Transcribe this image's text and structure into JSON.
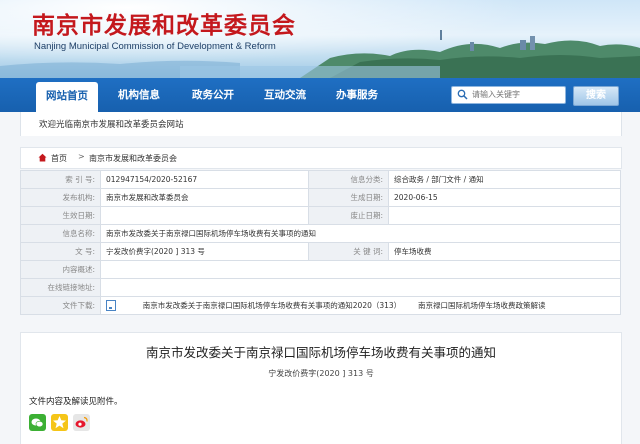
{
  "header": {
    "title": "南京市发展和改革委员会",
    "subtitle": "Nanjing Municipal Commission of Development & Reform"
  },
  "nav": {
    "items": [
      "网站首页",
      "机构信息",
      "政务公开",
      "互动交流",
      "办事服务"
    ],
    "active_index": 0
  },
  "search": {
    "placeholder": "请输入关键字",
    "button_label": "搜索"
  },
  "welcome": "欢迎光临南京市发展和改革委员会网站",
  "breadcrumb": [
    "首页",
    "南京市发展和改革委员会"
  ],
  "info_table": {
    "index_label": "索 引 号:",
    "index_value": "012947154/2020-52167",
    "category_label": "信息分类:",
    "category_value": "综合政务 / 部门文件 / 通知",
    "issuer_label": "发布机构:",
    "issuer_value": "南京市发展和改革委员会",
    "gen_date_label": "生成日期:",
    "gen_date_value": "2020-06-15",
    "effective_label": "生效日期:",
    "effective_value": "",
    "expiry_label": "废止日期:",
    "expiry_value": "",
    "name_label": "信息名称:",
    "name_value": "南京市发改委关于南京禄口国际机场停车场收费有关事项的通知",
    "docno_label": "文       号:",
    "docno_value": "宁发改价费字(2020 ] 313 号",
    "keywords_label": "关 键 词:",
    "keywords_value": "停车场收费",
    "overview_label": "内容概述:",
    "overview_value": "",
    "interview_label": "在线链接地址:",
    "interview_value": "",
    "download_label": "文件下载:",
    "download_file1": "南京市发改委关于南京禄口国际机场停车场收费有关事项的通知2020（313）",
    "download_file2": "南京禄口国际机场停车场收费政策解读"
  },
  "article": {
    "title": "南京市发改委关于南京禄口国际机场停车场收费有关事项的通知",
    "doc_number": "宁发改价费字(2020 ] 313 号",
    "body": "文件内容及解读见附件。"
  },
  "share_icons": [
    "wechat-icon",
    "qzone-icon",
    "weibo-icon"
  ],
  "colors": {
    "brand_red": "#c4181d",
    "nav_blue": "#1760ae"
  }
}
